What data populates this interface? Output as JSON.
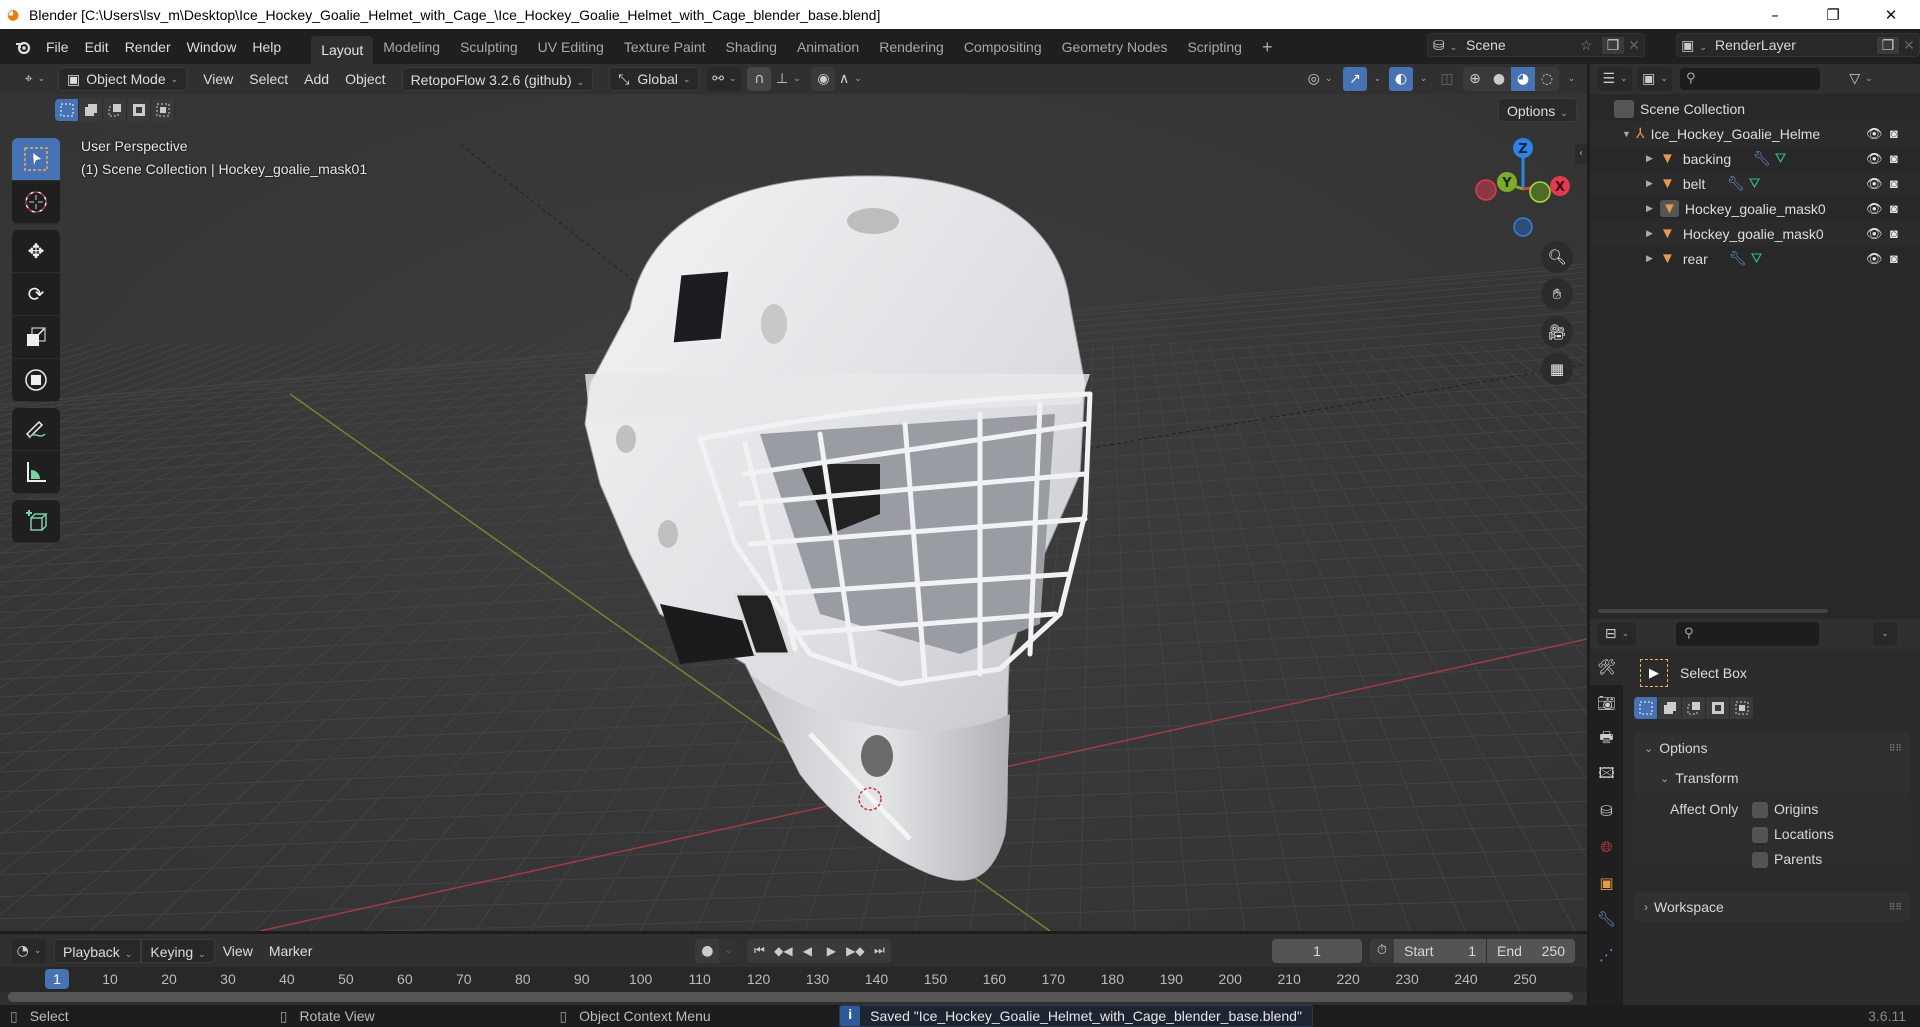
{
  "window": {
    "title": "Blender [C:\\Users\\lsv_m\\Desktop\\Ice_Hockey_Goalie_Helmet_with_Cage_\\Ice_Hockey_Goalie_Helmet_with_Cage_blender_base.blend]",
    "minimize": "–",
    "maximize": "❐",
    "close": "✕"
  },
  "menu": [
    "File",
    "Edit",
    "Render",
    "Window",
    "Help"
  ],
  "workspaces": {
    "tabs": [
      "Layout",
      "Modeling",
      "Sculpting",
      "UV Editing",
      "Texture Paint",
      "Shading",
      "Animation",
      "Rendering",
      "Compositing",
      "Geometry Nodes",
      "Scripting"
    ],
    "active": "Layout",
    "add": "+"
  },
  "scene": {
    "name": "Scene",
    "view_layer": "RenderLayer"
  },
  "viewport_header": {
    "mode": "Object Mode",
    "menus": [
      "View",
      "Select",
      "Add",
      "Object"
    ],
    "addon": "RetopoFlow 3.2.6 (github)",
    "orientation": "Global",
    "options": "Options"
  },
  "viewport": {
    "perspective": "User Perspective",
    "context": "(1) Scene Collection | Hockey_goalie_mask01",
    "gizmo": {
      "x": "X",
      "y": "Y",
      "z": "Z"
    },
    "colors": {
      "x": "#e2394f",
      "y": "#7bac2b",
      "z": "#2f84e3",
      "accent": "#4772b3"
    }
  },
  "tools": [
    "select-box",
    "cursor",
    "move",
    "rotate",
    "scale",
    "transform",
    "annotate",
    "measure",
    "add-cube"
  ],
  "outliner": {
    "root": "Scene Collection",
    "items": [
      {
        "name": "Ice_Hockey_Goalie_Helme",
        "type": "empty",
        "level": 0,
        "expanded": true,
        "modifier": false,
        "mesh": false
      },
      {
        "name": "backing",
        "type": "mesh",
        "level": 1,
        "modifier": true,
        "mesh": true
      },
      {
        "name": "belt",
        "type": "mesh",
        "level": 1,
        "modifier": true,
        "mesh": true
      },
      {
        "name": "Hockey_goalie_mask0",
        "type": "mesh",
        "level": 1,
        "modifier": false,
        "mesh": false,
        "active": true
      },
      {
        "name": "Hockey_goalie_mask0",
        "type": "mesh",
        "level": 1,
        "modifier": false,
        "mesh": false
      },
      {
        "name": "rear",
        "type": "mesh",
        "level": 1,
        "modifier": true,
        "mesh": true
      }
    ]
  },
  "properties": {
    "tool_name": "Select Box",
    "options_label": "Options",
    "transform_label": "Transform",
    "affect_only_label": "Affect Only",
    "checkboxes": [
      {
        "label": "Origins",
        "checked": false
      },
      {
        "label": "Locations",
        "checked": false
      },
      {
        "label": "Parents",
        "checked": false
      }
    ],
    "workspace_label": "Workspace"
  },
  "timeline": {
    "menus": [
      "Playback",
      "Keying",
      "View",
      "Marker"
    ],
    "current_frame": "1",
    "start_label": "Start",
    "start": "1",
    "end_label": "End",
    "end": "250",
    "ticks": [
      "10",
      "20",
      "30",
      "40",
      "50",
      "60",
      "70",
      "80",
      "90",
      "100",
      "110",
      "120",
      "130",
      "140",
      "150",
      "160",
      "170",
      "180",
      "190",
      "200",
      "210",
      "220",
      "230",
      "240",
      "250"
    ],
    "playhead": "1"
  },
  "statusbar": {
    "select": "Select",
    "rotate": "Rotate View",
    "context": "Object Context Menu",
    "message": "Saved \"Ice_Hockey_Goalie_Helmet_with_Cage_blender_base.blend\"",
    "version": "3.6.11"
  }
}
